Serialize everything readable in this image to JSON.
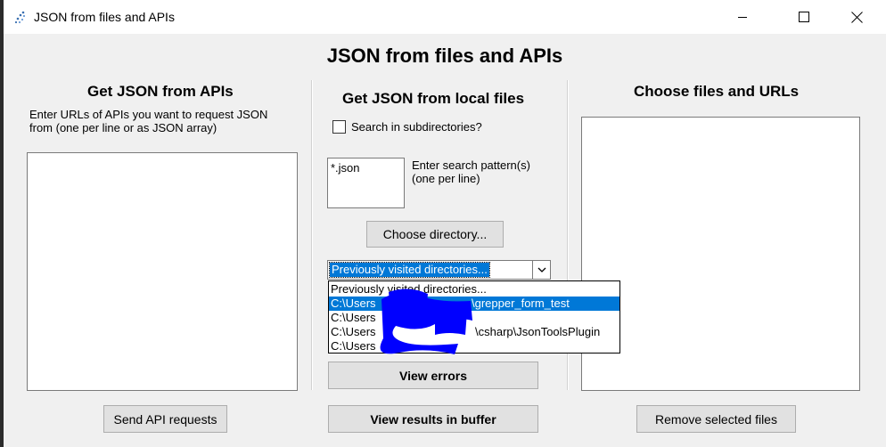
{
  "window": {
    "title": "JSON from files and APIs"
  },
  "form": {
    "title": "JSON from files and APIs"
  },
  "api_panel": {
    "heading": "Get JSON from APIs",
    "instructions_line1": "Enter URLs of APIs you want to request JSON",
    "instructions_line2": "from (one per line or as JSON array)",
    "urls_value": "",
    "send_button_label": "Send API requests"
  },
  "local_panel": {
    "heading": "Get JSON from local files",
    "subdir_label": "Search in subdirectories?",
    "subdir_checked": false,
    "pattern_value": "*.json",
    "pattern_label_line1": "Enter search pattern(s)",
    "pattern_label_line2": "(one per line)",
    "choose_directory_label": "Choose directory...",
    "combo_selected": "Previously visited directories...",
    "dropdown_items": [
      {
        "prefix": "Previously visited directories...",
        "suffix": ""
      },
      {
        "prefix": "C:\\Users",
        "suffix": "\\grepper_form_test"
      },
      {
        "prefix": "C:\\Users",
        "suffix": ""
      },
      {
        "prefix": "C:\\Users",
        "suffix": "\\csharp\\JsonToolsPlugin"
      },
      {
        "prefix": "C:\\Users",
        "suffix": ""
      }
    ],
    "dropdown_selected_index": 1,
    "view_errors_label": "View errors",
    "view_results_label": "View results in buffer"
  },
  "files_panel": {
    "heading": "Choose files and URLs",
    "remove_button_label": "Remove selected files"
  },
  "colors": {
    "accent": "#0078d7",
    "redaction": "#0000ff"
  }
}
